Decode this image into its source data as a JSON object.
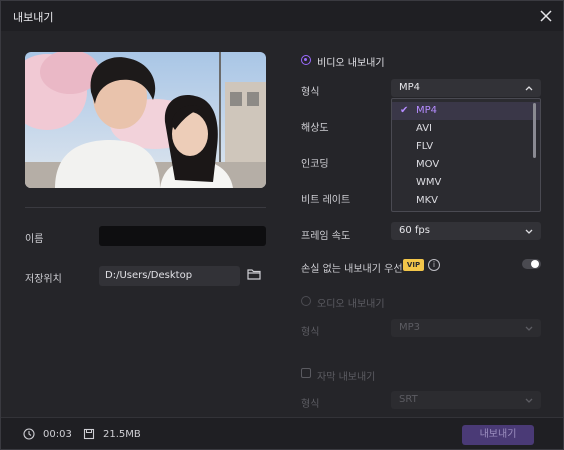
{
  "window": {
    "title": "내보내기"
  },
  "left": {
    "name_label": "이름",
    "name_value": "",
    "save_location_label": "저장위치",
    "save_path": "D:/Users/Desktop"
  },
  "video_export": {
    "label": "비디오 내보내기",
    "format_label": "형식",
    "format_value": "MP4",
    "resolution_label": "해상도",
    "encoding_label": "인코딩",
    "bitrate_label": "비트 레이트",
    "framerate_label": "프레임 속도",
    "framerate_value": "60  fps",
    "lossless_label": "손실 없는 내보내기 우선",
    "vip_badge": "VIP",
    "lossless_enabled": false
  },
  "format_dropdown": {
    "options": [
      "MP4",
      "AVI",
      "FLV",
      "MOV",
      "WMV",
      "MKV"
    ],
    "selected": "MP4"
  },
  "audio_export": {
    "label": "오디오 내보내기",
    "format_label": "형식",
    "format_value": "MP3"
  },
  "subtitle_export": {
    "label": "자막 내보내기",
    "format_label": "형식",
    "format_value": "SRT"
  },
  "footer": {
    "duration": "00:03",
    "size": "21.5MB",
    "export_label": "내보내기"
  },
  "colors": {
    "accent": "#9b6bff",
    "background": "#252529",
    "vip": "#f3c64a"
  }
}
